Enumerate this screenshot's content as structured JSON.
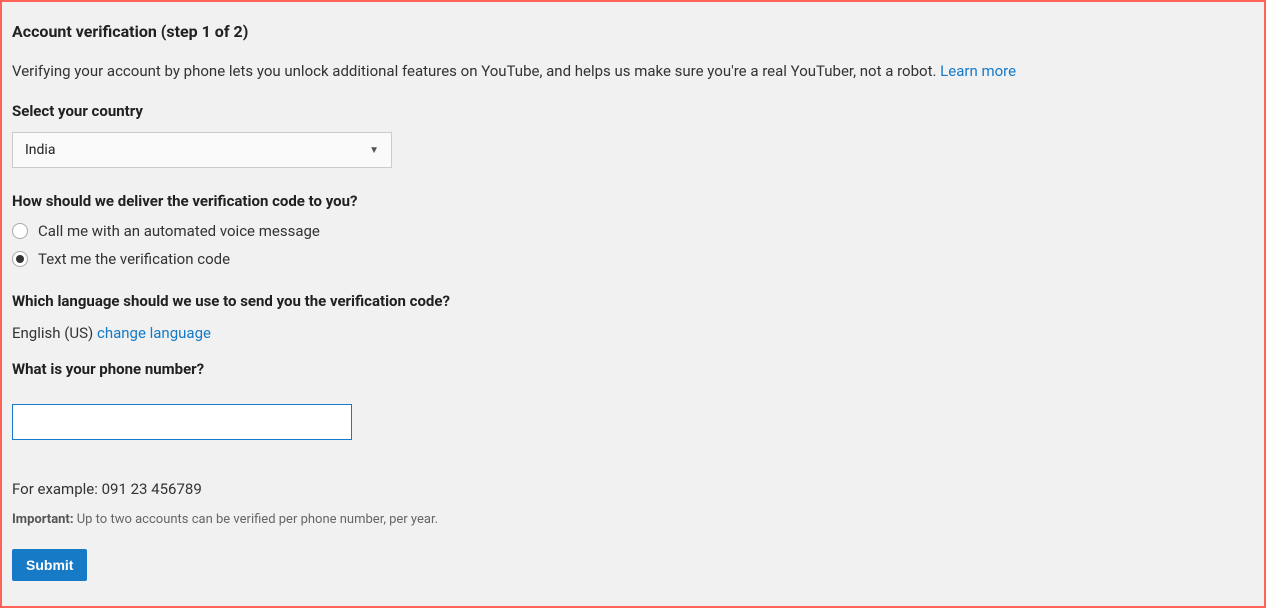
{
  "title": "Account verification (step 1 of 2)",
  "intro": "Verifying your account by phone lets you unlock additional features on YouTube, and helps us make sure you're a real YouTuber, not a robot. ",
  "learn_more": "Learn more",
  "country": {
    "label": "Select your country",
    "selected": "India"
  },
  "delivery": {
    "label": "How should we deliver the verification code to you?",
    "options": [
      {
        "label": "Call me with an automated voice message",
        "selected": false
      },
      {
        "label": "Text me the verification code",
        "selected": true
      }
    ]
  },
  "language": {
    "label": "Which language should we use to send you the verification code?",
    "current": "English (US) ",
    "change_link": "change language"
  },
  "phone": {
    "label": "What is your phone number?",
    "value": "",
    "example": "For example: 091 23 456789"
  },
  "important_label": "Important:",
  "important_text": " Up to two accounts can be verified per phone number, per year.",
  "submit": "Submit"
}
